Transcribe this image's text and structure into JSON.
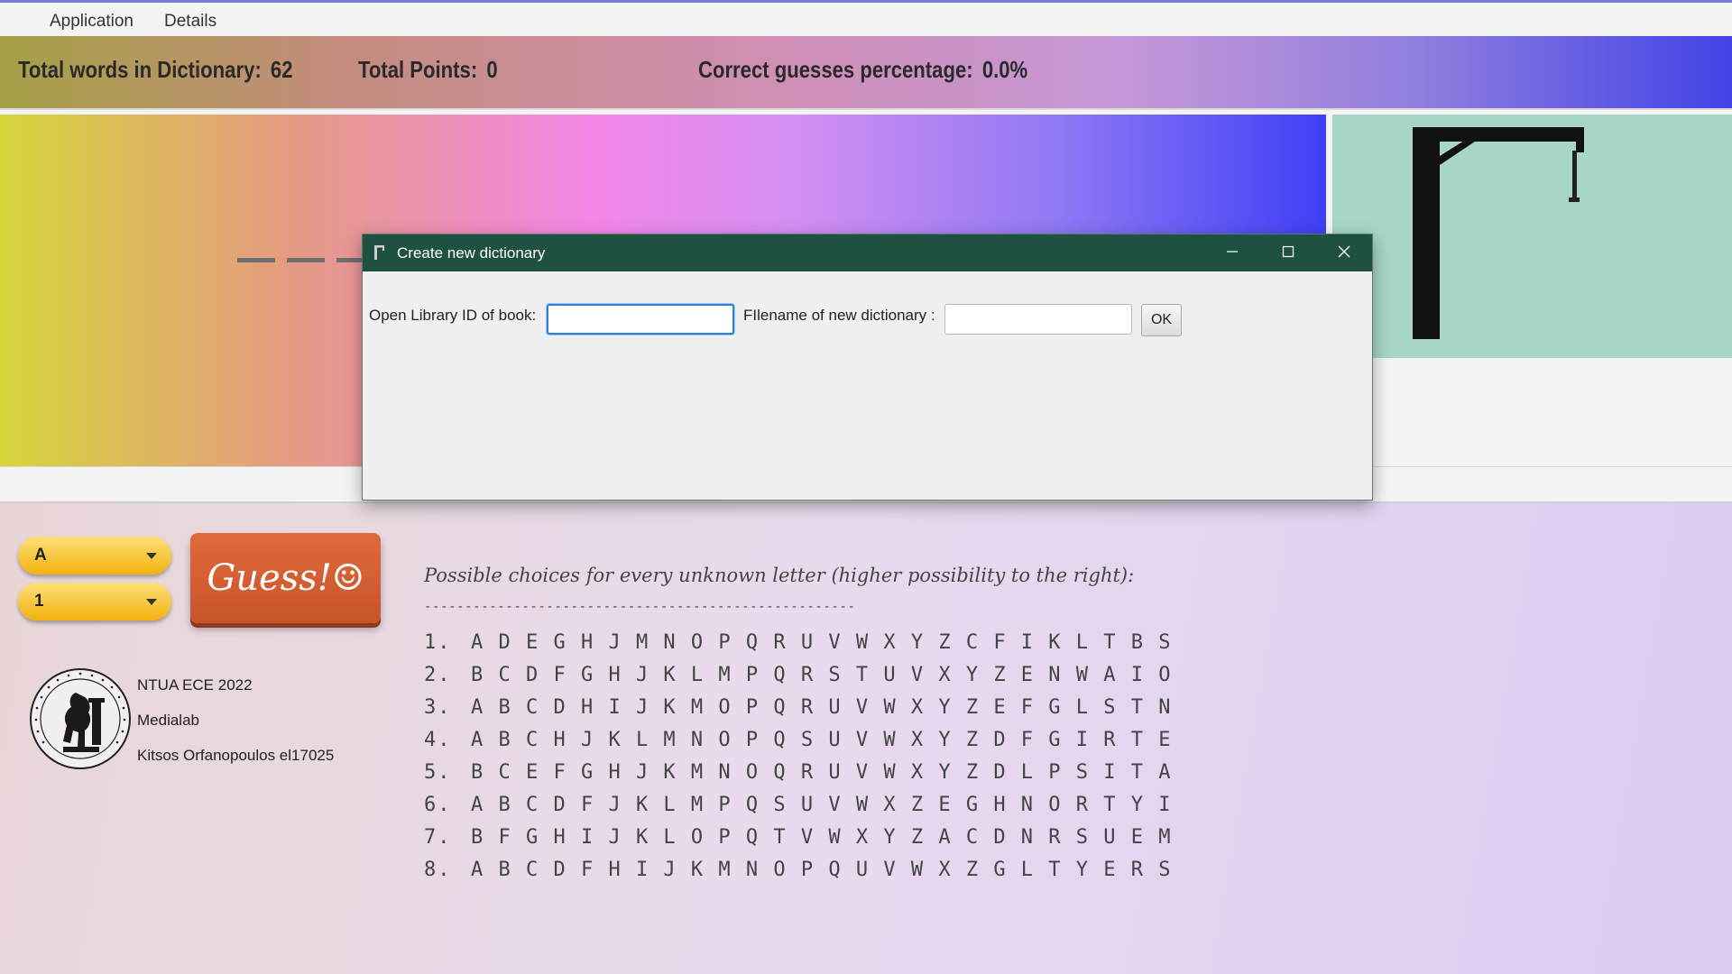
{
  "menu": {
    "items": [
      "Application",
      "Details"
    ]
  },
  "stats": {
    "words_label": "Total words in Dictionary:",
    "words_value": "62",
    "points_label": "Total Points:",
    "points_value": "0",
    "percent_label": "Correct guesses percentage:",
    "percent_value": "0.0%"
  },
  "controls": {
    "letter_value": "A",
    "position_value": "1",
    "guess_label": "Guess!☺"
  },
  "credits": {
    "line1": "NTUA ECE 2022",
    "line2": "Medialab",
    "line3": "Kitsos Orfanopoulos el17025"
  },
  "choices": {
    "title": "Possible choices for every unknown letter (higher possibility to the right):",
    "separator": "-----------------------------------------------------",
    "rows": [
      {
        "num": "1.",
        "letters": "A D E G H J M N O P Q R U V W X Y Z C F I K L T B S"
      },
      {
        "num": "2.",
        "letters": "B C D F G H J K L M P Q R S T U V X Y Z E N W A I O"
      },
      {
        "num": "3.",
        "letters": "A B C D H I J K M O P Q R U V W X Y Z E F G L S T N"
      },
      {
        "num": "4.",
        "letters": "A B C H J K L M N O P Q S U V W X Y Z D F G I R T E"
      },
      {
        "num": "5.",
        "letters": "B C E F G H J K M N O Q R U V W X Y Z D L P S I T A"
      },
      {
        "num": "6.",
        "letters": "A B C D F J K L M P Q S U V W X Z E G H N O R T Y I"
      },
      {
        "num": "7.",
        "letters": "B F G H I J K L O P Q T V W X Y Z A C D N R S U E M"
      },
      {
        "num": "8.",
        "letters": "A B C D F H I J K M N O P Q U V W X Z G L T Y E R S"
      }
    ]
  },
  "dialog": {
    "title": "Create new dictionary",
    "library_label": "Open Library ID of book:",
    "library_value": "",
    "filename_label": "FIlename of new dictionary :",
    "filename_value": "",
    "ok_label": "OK",
    "minimize_icon": "minimize-icon",
    "maximize_icon": "maximize-icon",
    "close_icon": "close-icon"
  },
  "colors": {
    "dialog_titlebar": "#1f5143",
    "gallows_bg": "#a8d6c6",
    "guess_button": "#d65e31",
    "combo_yellow": "#f8c83a"
  }
}
